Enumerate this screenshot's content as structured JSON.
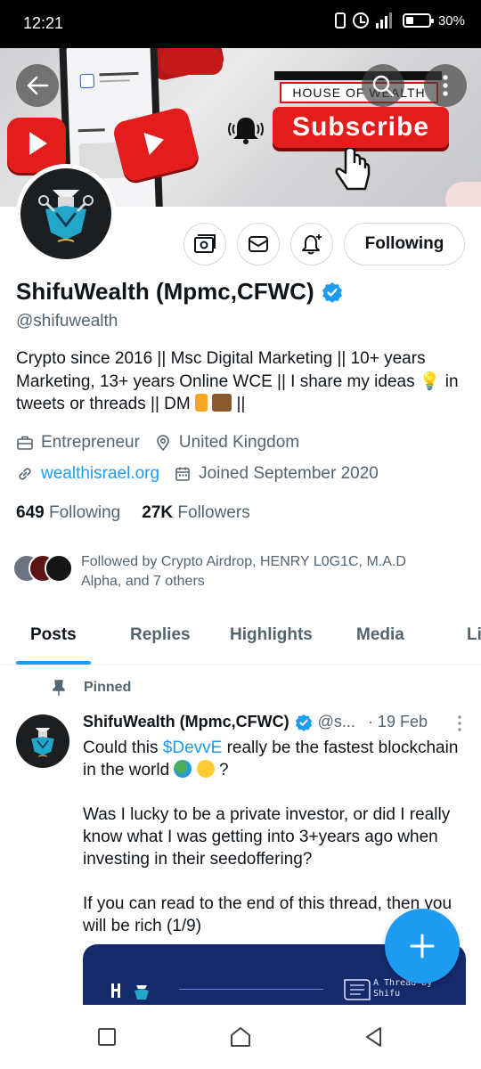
{
  "status_bar": {
    "time": "12:21",
    "battery": "30%"
  },
  "banner": {
    "brand_text": "HOUSE OF WEALTH",
    "subscribe_label": "Subscribe"
  },
  "profile": {
    "name": "ShifuWealth (Mpmc,CFWC)",
    "handle": "@shifuwealth",
    "bio": "Crypto since 2016 || Msc Digital Marketing || 10+ years Marketing, 13+ years Online WCE || I share my ideas 💡 in tweets or threads || DM ",
    "bio_end": " ||",
    "category": "Entrepreneur",
    "location": "United Kingdom",
    "website": "wealthisrael.org",
    "joined": "Joined September 2020",
    "following_count": "649",
    "following_label": "Following",
    "followers_count": "27K",
    "followers_label": "Followers",
    "followed_by": "Followed by Crypto Airdrop, HENRY L0G1C, M.A.D Alpha, and 7 others",
    "follow_button": "Following"
  },
  "tabs": [
    {
      "label": "Posts"
    },
    {
      "label": "Replies"
    },
    {
      "label": "Highlights"
    },
    {
      "label": "Media"
    },
    {
      "label": "Li"
    }
  ],
  "post": {
    "pinned_label": "Pinned",
    "author": "ShifuWealth (Mpmc,CFWC)",
    "handle": "@s...",
    "date": "· 19 Feb",
    "line1_pre": "Could this ",
    "cashtag": "$DevvE",
    "line1_post": " really be the fastest blockchain in the world ",
    "line1_end": " ?",
    "para2": "Was I lucky to be a private investor, or did I really know what I was getting into 3+years ago when investing in their seedoffering?",
    "para3": "If you can read to the end of this thread, then you will be rich    (1/9)",
    "image_caption_1": "A Thread by",
    "image_caption_2": "Shifu"
  },
  "colors": {
    "accent": "#1d9bf0",
    "text_primary": "#0f1419",
    "text_secondary": "#536471",
    "subscribe_red": "#e31c1c"
  }
}
